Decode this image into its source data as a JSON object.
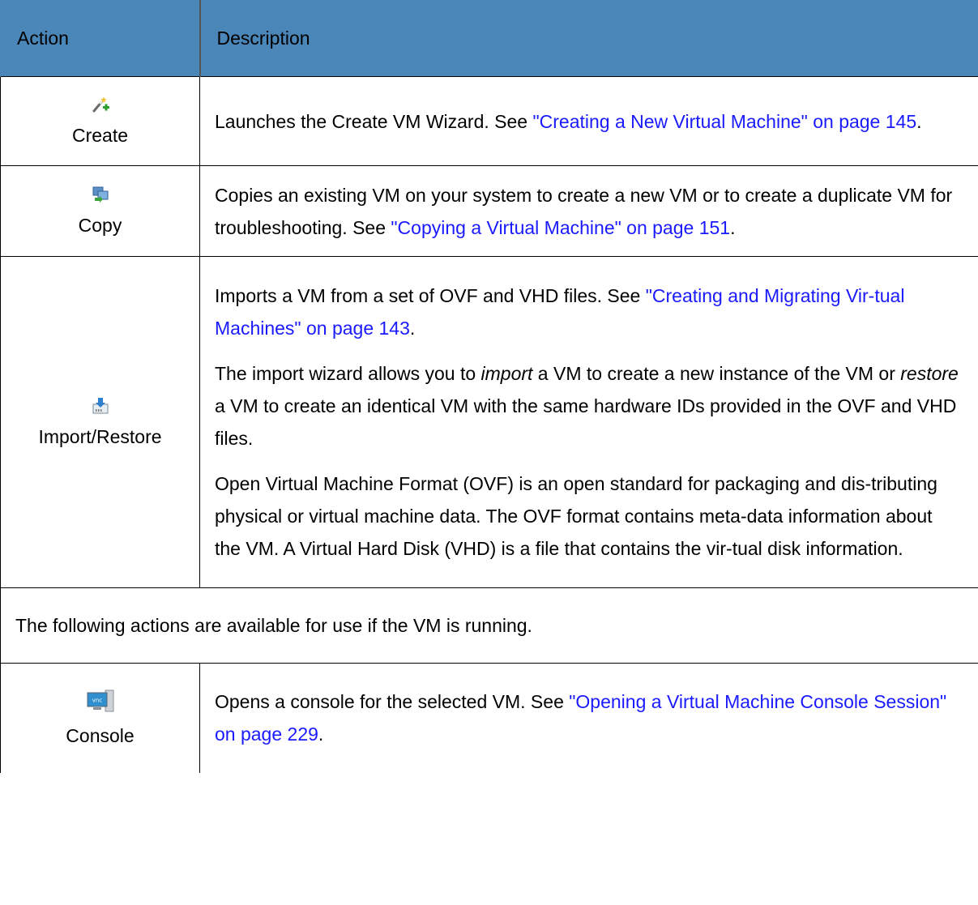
{
  "header": {
    "action": "Action",
    "description": "Description"
  },
  "rows": [
    {
      "action": "Create",
      "icon": "wand-plus-icon",
      "p1_pre": "Launches the Create VM Wizard. See ",
      "p1_link": "\"Creating a New Virtual Machine\" on page 145",
      "p1_post": "."
    },
    {
      "action": "Copy",
      "icon": "copy-vm-icon",
      "p1_pre": "Copies an existing VM on your system to create a new VM or to create a duplicate VM for troubleshooting. See ",
      "p1_link": "\"Copying a Virtual Machine\" on page 151",
      "p1_post": "."
    },
    {
      "action": "Import/Restore",
      "icon": "import-icon",
      "p1_pre": "Imports a VM from a set of OVF and VHD files. See ",
      "p1_link": "\"Creating and Migrating Vir-tual Machines\" on page 143",
      "p1_post": ".",
      "p2_a": "The import wizard allows you to ",
      "p2_em1": "import",
      "p2_b": " a VM to create a new instance of the VM or ",
      "p2_em2": "restore",
      "p2_c": " a VM to create an identical VM with the same hardware IDs provided in the OVF and VHD files.",
      "p3": "Open Virtual Machine Format (OVF) is an open standard for packaging and dis-tributing physical or virtual machine data. The OVF format contains meta-data information about the VM. A Virtual Hard Disk (VHD) is a file that contains the vir-tual disk information."
    }
  ],
  "note": "The following actions are available for use if the VM is running.",
  "console": {
    "action": "Console",
    "icon": "vnc-console-icon",
    "p1_pre": "Opens a console for the selected VM. See ",
    "p1_link": "\"Opening a Virtual Machine Console Session\" on page 229",
    "p1_post": "."
  }
}
